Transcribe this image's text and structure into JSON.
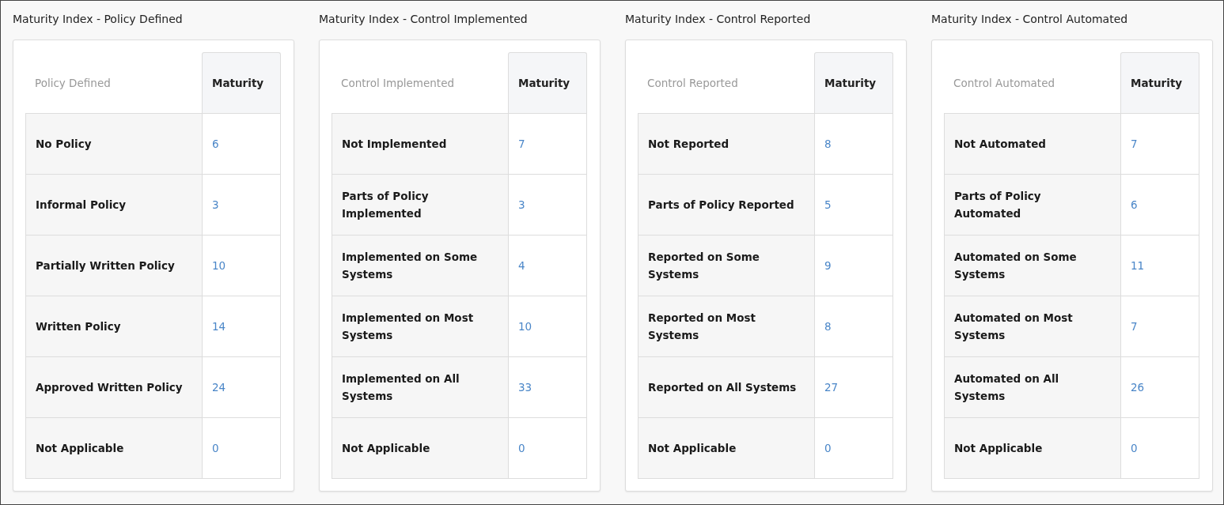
{
  "panels": [
    {
      "title": "Maturity Index - Policy Defined",
      "columns": [
        "Policy Defined",
        "Maturity"
      ],
      "rows": [
        {
          "label": "No Policy",
          "value": "6"
        },
        {
          "label": "Informal Policy",
          "value": "3"
        },
        {
          "label": "Partially Written Policy",
          "value": "10"
        },
        {
          "label": "Written Policy",
          "value": "14"
        },
        {
          "label": "Approved Written Policy",
          "value": "24"
        },
        {
          "label": "Not Applicable",
          "value": "0"
        }
      ]
    },
    {
      "title": "Maturity Index - Control Implemented",
      "columns": [
        "Control Implemented",
        "Maturity"
      ],
      "rows": [
        {
          "label": "Not Implemented",
          "value": "7"
        },
        {
          "label": "Parts of Policy Implemented",
          "value": "3"
        },
        {
          "label": "Implemented on Some Systems",
          "value": "4"
        },
        {
          "label": "Implemented on Most Systems",
          "value": "10"
        },
        {
          "label": "Implemented on All Systems",
          "value": "33"
        },
        {
          "label": "Not Applicable",
          "value": "0"
        }
      ]
    },
    {
      "title": "Maturity Index - Control Reported",
      "columns": [
        "Control Reported",
        "Maturity"
      ],
      "rows": [
        {
          "label": "Not Reported",
          "value": "8"
        },
        {
          "label": "Parts of Policy Reported",
          "value": "5"
        },
        {
          "label": "Reported on Some Systems",
          "value": "9"
        },
        {
          "label": "Reported on Most Systems",
          "value": "8"
        },
        {
          "label": "Reported on All Systems",
          "value": "27"
        },
        {
          "label": "Not Applicable",
          "value": "0"
        }
      ]
    },
    {
      "title": "Maturity Index - Control Automated",
      "columns": [
        "Control Automated",
        "Maturity"
      ],
      "rows": [
        {
          "label": "Not Automated",
          "value": "7"
        },
        {
          "label": "Parts of Policy Automated",
          "value": "6"
        },
        {
          "label": "Automated on Some Systems",
          "value": "11"
        },
        {
          "label": "Automated on Most Systems",
          "value": "7"
        },
        {
          "label": "Automated on All Systems",
          "value": "26"
        },
        {
          "label": "Not Applicable",
          "value": "0"
        }
      ]
    }
  ]
}
